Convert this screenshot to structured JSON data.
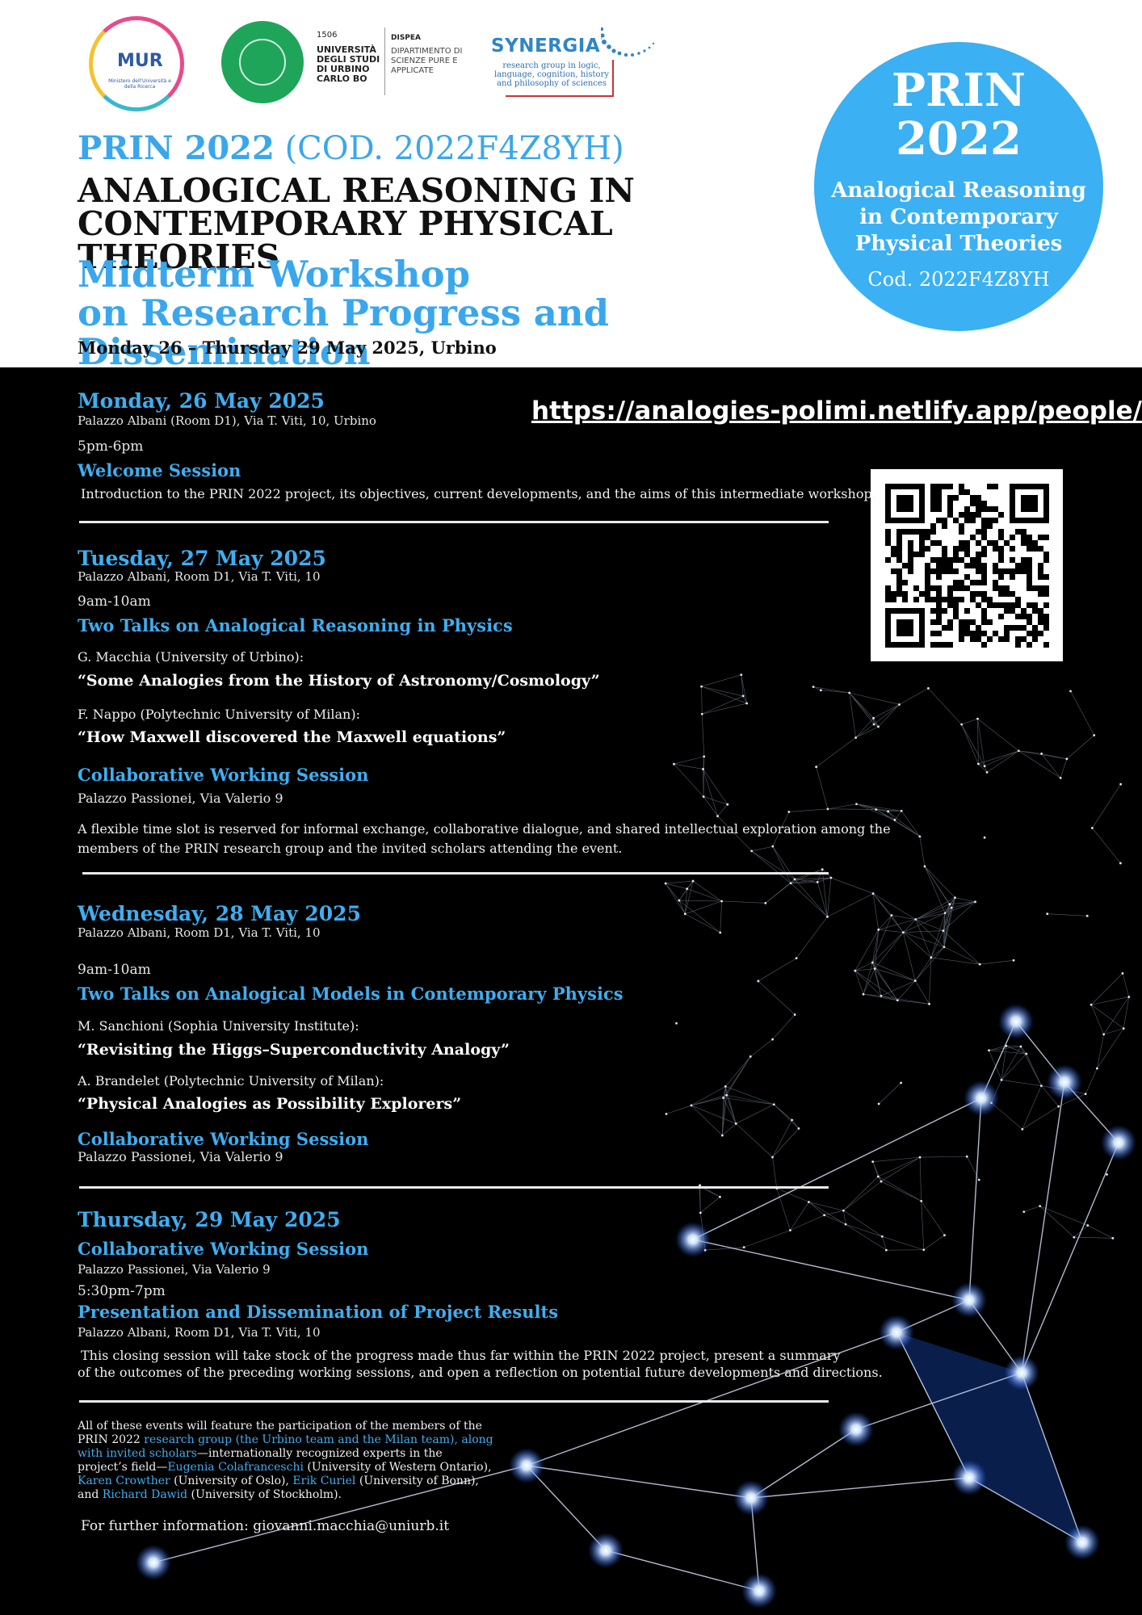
{
  "logos": {
    "mur": {
      "label": "MUR",
      "sub": "Ministero dell'Università e della Ricerca",
      "colors": [
        "#e84a8a",
        "#f3c232",
        "#39b8c9",
        "#2d5aa8"
      ]
    },
    "uniurb": {
      "year": "1506",
      "name": "UNIVERSITÀ DEGLI STUDI DI URBINO CARLO BO",
      "color": "#1ea55a"
    },
    "dispea": {
      "acronym": "DISPEA",
      "name": "DIPARTIMENTO DI SCIENZE PURE E APPLICATE"
    },
    "synergia": {
      "name": "SYNERGIA",
      "sub": "research group in logic, language, cognition, history and philosophy of sciences"
    }
  },
  "header": {
    "prin_bold": "PRIN 2022",
    "prin_code": " (COD. 2022F4Z8YH)",
    "title_line1": "ANALOGICAL REASONING IN",
    "title_line2": "CONTEMPORARY PHYSICAL THEORIES",
    "subtitle_line1": "Midterm Workshop",
    "subtitle_line2": "on Research Progress and Dissemination",
    "dates": "Monday 26 – Thursday 29 May 2025, Urbino"
  },
  "badge": {
    "line1": "PRIN",
    "line2": "2022",
    "line3": "Analogical Reasoning",
    "line4": "in Contemporary",
    "line5": "Physical Theories",
    "code": "Cod. 2022F4Z8YH",
    "color": "#3bb0f3"
  },
  "url": "https://analogies-polimi.netlify.app/people/",
  "days": {
    "mon": {
      "date": "Monday, 26 May 2025",
      "place": "Palazzo Albani (Room D1), Via T. Viti, 10, Urbino",
      "time": "5pm-6pm",
      "session": "Welcome Session",
      "desc": "Introduction to the PRIN 2022 project, its objectives, current developments, and the aims of this intermediate workshop."
    },
    "tue": {
      "date": "Tuesday, 27 May 2025",
      "place": "Palazzo Albani, Room D1, Via T. Viti, 10",
      "time": "9am-10am",
      "session": "Two Talks on Analogical Reasoning in Physics",
      "speaker1": "G. Macchia (University of Urbino):",
      "talk1": "“Some Analogies from the History of Astronomy/Cosmology”",
      "speaker2": "F. Nappo (Polytechnic University of Milan):",
      "talk2": "“How Maxwell discovered the Maxwell equations”",
      "session2": "Collaborative Working Session",
      "place2": "Palazzo Passionei, Via Valerio 9",
      "desc_line1": "A flexible time slot is reserved for informal exchange, collaborative dialogue, and shared intellectual exploration among the",
      "desc_line2": "members of the PRIN research group and the invited scholars attending the event."
    },
    "wed": {
      "date": "Wednesday, 28 May 2025",
      "place": "Palazzo Albani, Room D1, Via T. Viti, 10",
      "time": "9am-10am",
      "session": "Two Talks on Analogical Models in Contemporary Physics",
      "speaker1": "M. Sanchioni (Sophia University Institute):",
      "talk1": "“Revisiting the Higgs–Superconductivity Analogy”",
      "speaker2": "A. Brandelet (Polytechnic University of Milan):",
      "talk2": "“Physical Analogies as Possibility Explorers”",
      "session2": "Collaborative Working Session",
      "place2": "Palazzo Passionei, Via Valerio 9"
    },
    "thu": {
      "date": "Thursday, 29 May 2025",
      "session1": "Collaborative Working Session",
      "place1": "Palazzo Passionei, Via Valerio 9",
      "time": "5:30pm-7pm",
      "session2": "Presentation and Dissemination of Project Results",
      "place2": "Palazzo Albani, Room D1, Via T. Viti, 10",
      "desc_line1": "This closing session will take stock of the progress made thus far within the PRIN 2022 project, present a summary",
      "desc_line2": "of the outcomes of the preceding working sessions, and open a reflection on potential future developments and directions."
    }
  },
  "footer": {
    "t1": "All of these events will feature the participation of the members of the",
    "t2a": "PRIN 2022 ",
    "t2b": "research group (the Urbino team and the Milan team), along",
    "t3a": "with invited scholars",
    "t3b": "—internationally recognized experts in the",
    "t4a": "project’s field—",
    "t4b": "Eugenia Colafranceschi",
    "t4c": " (University of Western Ontario),",
    "t5a": "Karen Crowther",
    "t5b": " (University of Oslo), ",
    "t5c": "Erik Curiel",
    "t5d": " (University of Bonn),",
    "t6a": "and ",
    "t6b": "Richard Dawid",
    "t6c": " (University of Stockholm).",
    "contact": "For further information: giovanni.macchia@uniurb.it"
  },
  "colors": {
    "accent": "#3eaef0",
    "background": "#000000",
    "header_bg": "#ffffff"
  }
}
